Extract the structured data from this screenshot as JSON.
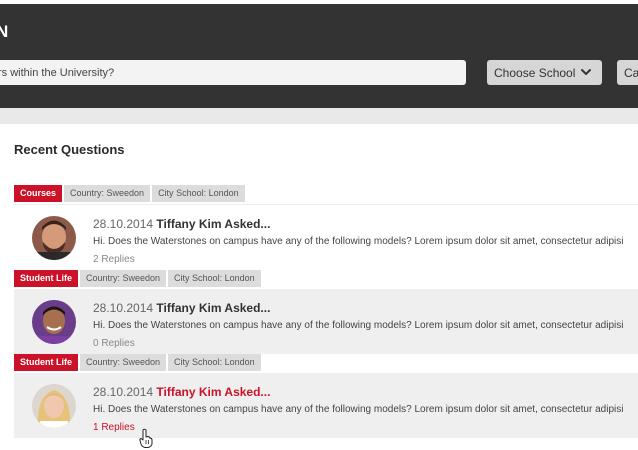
{
  "header": {
    "title": "N",
    "search": {
      "value": "",
      "placeholder": "rs within the University?"
    },
    "school_dropdown": {
      "label": "Choose School",
      "icon": "chevron-down-icon"
    },
    "category_dropdown": {
      "label": "Cat"
    }
  },
  "recent": {
    "title": "Recent Questions",
    "questions": [
      {
        "tags": [
          "Courses",
          "Country: Sweedon",
          "City School: London"
        ],
        "date": "28.10.2014",
        "asker": "Tiffany Kim Asked...",
        "text": "Hi. Does the Waterstones on campus have any of the following models? Lorem ipsum dolor sit amet, consectetur adipisi",
        "replies": "2 Replies"
      },
      {
        "tags": [
          "Student Life",
          "Country: Sweedon",
          "City School: London"
        ],
        "date": "28.10.2014",
        "asker": "Tiffany Kim Asked...",
        "text": "Hi. Does the Waterstones on campus have any of the following models? Lorem ipsum dolor sit amet, consectetur adipisi",
        "replies": "0 Replies"
      },
      {
        "tags": [
          "Student Life",
          "Country: Sweedon",
          "City School: London"
        ],
        "date": "28.10.2014",
        "asker": "Tiffany Kim Asked...",
        "text": "Hi. Does the Waterstones on campus have any of the following models? Lorem ipsum dolor sit amet, consectetur adipisi",
        "replies": "1 Replies"
      }
    ]
  },
  "colors": {
    "accent": "#cc1228",
    "header_bg": "#333333",
    "tag_bg": "#dcdcdc"
  }
}
